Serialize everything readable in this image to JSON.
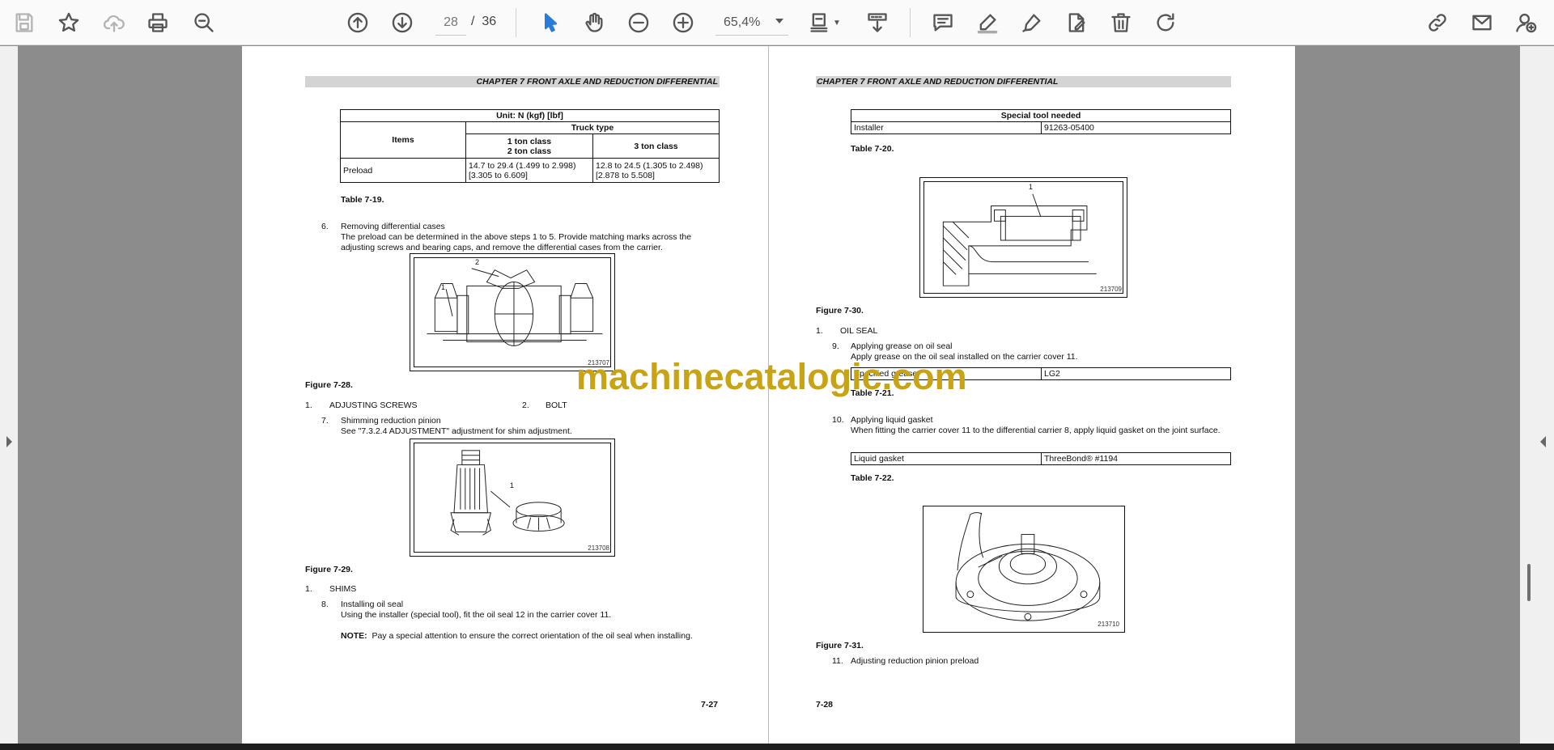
{
  "toolbar": {
    "page_current": "28",
    "page_separator": "/",
    "page_total": "36",
    "zoom": "65,4%"
  },
  "watermark": "machinecatalogic.com",
  "left_page": {
    "header": "CHAPTER 7 FRONT AXLE AND REDUCTION DIFFERENTIAL",
    "table": {
      "unit": "Unit: N (kgf) [lbf]",
      "items_label": "Items",
      "truck_type": "Truck type",
      "col1_line1": "1 ton class",
      "col1_line2": "2 ton class",
      "col2": "3 ton class",
      "row_label": "Preload",
      "cell1_line1": "14.7 to 29.4 (1.499 to 2.998)",
      "cell1_line2": "[3.305 to 6.609]",
      "cell2_line1": "12.8 to 24.5 (1.305 to 2.498)",
      "cell2_line2": "[2.878 to 5.508]",
      "caption": "Table 7-19."
    },
    "step6": {
      "num": "6.",
      "title": "Removing differential cases",
      "text": "The preload can be determined in the above steps 1 to 5. Provide matching marks across the adjusting screws and bearing caps, and remove the differential cases from the carrier."
    },
    "fig28": {
      "label1": "1",
      "label2": "2",
      "code": "213707",
      "caption": "Figure 7-28."
    },
    "fig28_legend": {
      "n1": "1.",
      "t1": "ADJUSTING SCREWS",
      "n2": "2.",
      "t2": "BOLT"
    },
    "step7": {
      "num": "7.",
      "title": "Shimming reduction pinion",
      "text": "See \"7.3.2.4 ADJUSTMENT\" adjustment for shim adjustment."
    },
    "fig29": {
      "label1": "1",
      "code": "213708",
      "caption": "Figure 7-29."
    },
    "fig29_legend": {
      "n1": "1.",
      "t1": "SHIMS"
    },
    "step8": {
      "num": "8.",
      "title": "Installing oil seal",
      "text": "Using the installer (special tool), fit the oil seal 12 in the carrier cover 11."
    },
    "note": {
      "label": "NOTE:",
      "text": "Pay a special attention to ensure the correct orientation of the oil seal when installing."
    },
    "page_number": "7-27"
  },
  "right_page": {
    "header": "CHAPTER 7 FRONT AXLE AND REDUCTION DIFFERENTIAL",
    "table20": {
      "heading": "Special tool needed",
      "c1": "Installer",
      "c2": "91263-05400",
      "caption": "Table 7-20."
    },
    "fig30": {
      "label1": "1",
      "code": "213709",
      "caption": "Figure 7-30."
    },
    "fig30_legend": {
      "n1": "1.",
      "t1": "OIL SEAL"
    },
    "step9": {
      "num": "9.",
      "title": "Applying grease on oil seal",
      "text": "Apply grease on the oil seal installed on the carrier cover 11."
    },
    "table21": {
      "c1": "Specified grease",
      "c2": "LG2",
      "caption": "Table 7-21."
    },
    "step10": {
      "num": "10.",
      "title": "Applying liquid gasket",
      "text": "When fitting the carrier cover 11 to the differential carrier 8, apply liquid gasket on the joint surface."
    },
    "table22": {
      "c1": "Liquid gasket",
      "c2": "ThreeBond® #1194",
      "caption": "Table 7-22."
    },
    "fig31": {
      "code": "213710",
      "caption": "Figure 7-31."
    },
    "step11": {
      "num": "11.",
      "title": "Adjusting reduction pinion preload"
    },
    "page_number": "7-28"
  }
}
